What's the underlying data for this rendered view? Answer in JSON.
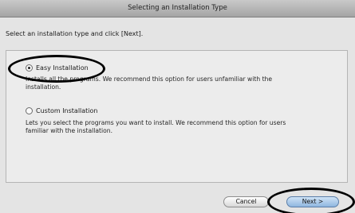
{
  "window": {
    "title": "Selecting an Installation Type"
  },
  "instruction": "Select an installation type and click [Next].",
  "options": [
    {
      "label": "Easy Installation",
      "selected": true,
      "description_line1": "Installs all the programs. We recommend this option for users unfamiliar with the",
      "description_line2": "installation."
    },
    {
      "label": "Custom Installation",
      "selected": false,
      "description_line1": "Lets you select the programs you want to install. We recommend this option for users",
      "description_line2": "familiar with the installation."
    }
  ],
  "buttons": {
    "cancel_label": "Cancel",
    "next_label": "Next >"
  },
  "colors": {
    "annotation_circle": "#000000",
    "default_button": "#8fb6df"
  }
}
